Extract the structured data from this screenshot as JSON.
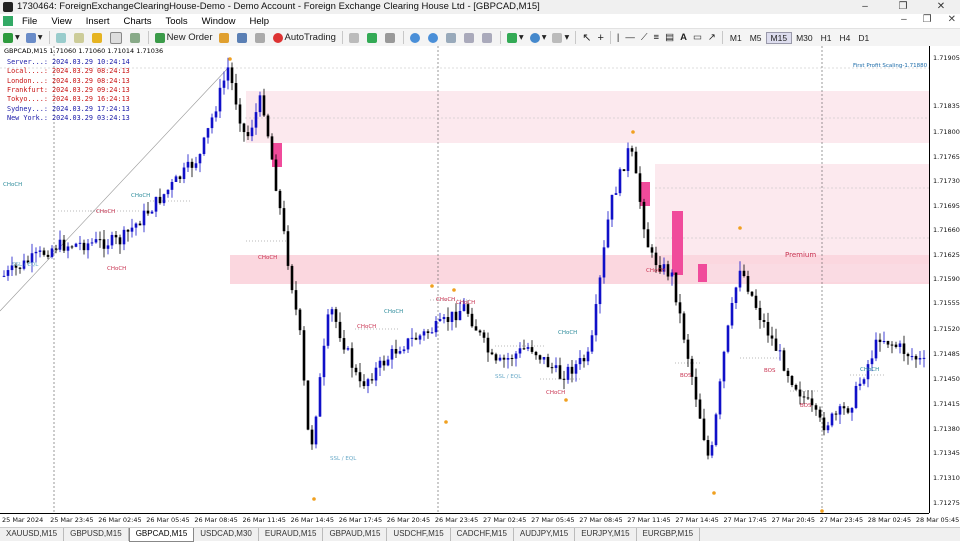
{
  "window": {
    "title": "1730464: ForeignExchangeClearingHouse-Demo - Demo Account - Foreign Exchange Clearing House Ltd - [GBPCAD,M15]",
    "controls": [
      "–",
      "❐",
      "✕"
    ]
  },
  "menu": {
    "items": [
      "File",
      "View",
      "Insert",
      "Charts",
      "Tools",
      "Window",
      "Help"
    ],
    "right_controls": [
      "–",
      "❐",
      "✕"
    ]
  },
  "toolbar": {
    "new_order_label": "New Order",
    "autotrading_label": "AutoTrading",
    "timeframes": [
      "M1",
      "M5",
      "M15",
      "M30",
      "H1",
      "H4",
      "D1"
    ],
    "active_timeframe": "M15"
  },
  "chart": {
    "header": "GBPCAD,M15  1.71060 1.71060 1.71014 1.71036",
    "clocks": [
      {
        "label": "Server...:",
        "value": "2024.03.29 10:24:14",
        "color": "#1a1aa8"
      },
      {
        "label": "Local....:",
        "value": "2024.03.29 08:24:13",
        "color": "#c81414"
      },
      {
        "label": "London...:",
        "value": "2024.03.29 08:24:13",
        "color": "#c81414"
      },
      {
        "label": "Frankfurt:",
        "value": "2024.03.29 09:24:13",
        "color": "#c81414"
      },
      {
        "label": "Tokyo....:",
        "value": "2024.03.29 16:24:13",
        "color": "#c81414"
      },
      {
        "label": "Sydney...:",
        "value": "2024.03.29 17:24:13",
        "color": "#1a1aa8"
      },
      {
        "label": "New York.:",
        "value": "2024.03.29 03:24:13",
        "color": "#1a1aa8"
      }
    ],
    "y_labels": [
      "1.71905",
      "1.71835",
      "1.71800",
      "1.71765",
      "1.71730",
      "1.71695",
      "1.71660",
      "1.71625",
      "1.71590",
      "1.71555",
      "1.71520",
      "1.71485",
      "1.71450",
      "1.71415",
      "1.71380",
      "1.71345",
      "1.71310",
      "1.71275"
    ],
    "x_labels": [
      "25 Mar 2024",
      "25 Mar 23:45",
      "26 Mar 02:45",
      "26 Mar 05:45",
      "26 Mar 08:45",
      "26 Mar 11:45",
      "26 Mar 14:45",
      "26 Mar 17:45",
      "26 Mar 20:45",
      "26 Mar 23:45",
      "27 Mar 02:45",
      "27 Mar 05:45",
      "27 Mar 08:45",
      "27 Mar 11:45",
      "27 Mar 14:45",
      "27 Mar 17:45",
      "27 Mar 20:45",
      "27 Mar 23:45",
      "28 Mar 02:45",
      "28 Mar 05:45"
    ],
    "annotations": {
      "first_profit": "First Profit Scaling-1.71880",
      "premium": "Premium",
      "choch": "CHoCH",
      "bos": "BOS",
      "ssl": "SSL / EQL"
    },
    "colors": {
      "bull": "#1010c8",
      "bear": "#000000",
      "zone": "#fbd7df",
      "zone_light": "#fce9ee",
      "ob": "#f04b9b",
      "dot": "#f0a020"
    }
  },
  "tabs": {
    "items": [
      "XAUUSD,M15",
      "GBPUSD,M15",
      "GBPCAD,M15",
      "USDCAD,M30",
      "EURAUD,M15",
      "GBPAUD,M15",
      "USDCHF,M15",
      "CADCHF,M15",
      "AUDJPY,M15",
      "EURJPY,M15",
      "EURGBP,M15"
    ],
    "active": "GBPCAD,M15"
  }
}
